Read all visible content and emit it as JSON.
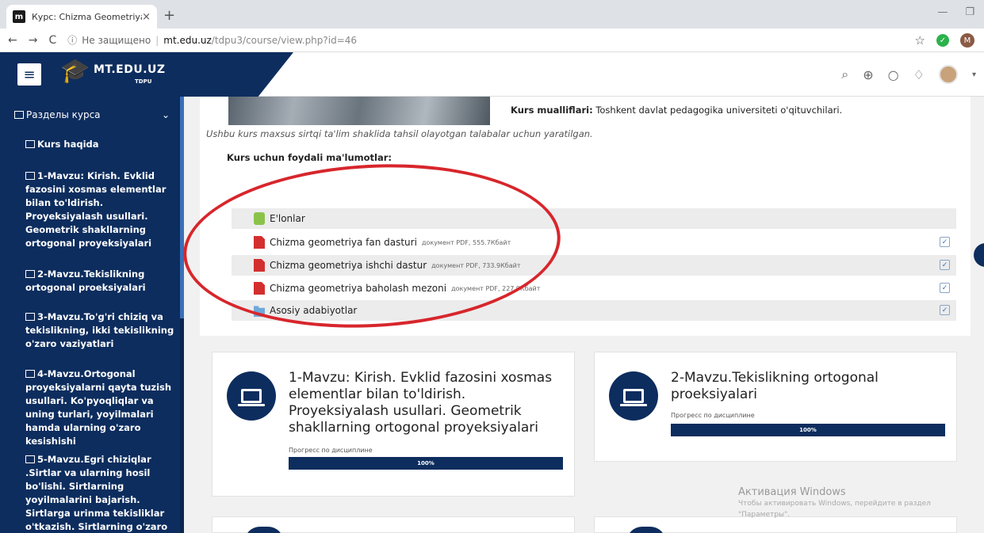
{
  "browser": {
    "tab_title": "Курс: Chizma Geometriya",
    "favicon_letter": "m",
    "tab_close": "×",
    "new_tab": "+",
    "insecure_label": "Не защищено",
    "url_host": "mt.edu.uz",
    "url_path": "/tdpu3/course/view.php?id=46",
    "profile_letter": "M"
  },
  "site": {
    "brand_name": "MT.EDU.UZ",
    "brand_sub": "TDPU"
  },
  "sidebar": {
    "heading": "Разделы курса",
    "items": [
      "Kurs haqida",
      "1-Mavzu: Kirish. Evklid fazosini xosmas elementlar bilan to'ldirish. Proyeksiyalash usullari. Geometrik shakllarning ortogonal proyeksiyalari",
      "2-Mavzu.Tekislikning ortogonal proeksiyalari",
      "3-Mavzu.To'g'ri chiziq va tekislikning, ikki tekislikning o'zaro vaziyatlari",
      "4-Mavzu.Ortogonal proyeksiyalarni qayta tuzish usullari. Ko'pyoqliqlar va uning turlari, yoyilmalari hamda ularning o'zaro kesishishi",
      "5-Mavzu.Egri chiziqlar .Sirtlar va ularning hosil bo'lishi. Sirtlarning yoyilmalarini bajarish. Sirtlarga urinma tekisliklar o'tkazish. Sirtlarning o'zaro kesishishi"
    ]
  },
  "course": {
    "authors_label": "Kurs mualliflari:",
    "authors_text": " Toshkent davlat pedagogika universiteti o'qituvchilari.",
    "description": "Ushbu kurs maxsus sirtqi ta'lim shaklida tahsil olayotgan talabalar uchun yaratilgan.",
    "useful_heading": "Kurs uchun foydali ma'lumotlar:",
    "resources": [
      {
        "label": "E'lonlar",
        "meta": ""
      },
      {
        "label": "Chizma geometriya fan dasturi",
        "meta": "документ PDF, 555.7Кбайт"
      },
      {
        "label": "Chizma geometriya ishchi dastur",
        "meta": "документ PDF, 733.9Кбайт"
      },
      {
        "label": "Chizma geometriya baholash mezoni",
        "meta": "документ PDF, 227.9Кбайт"
      },
      {
        "label": "Asosiy adabiyotlar",
        "meta": ""
      }
    ],
    "check_mark": "✓"
  },
  "topics": [
    {
      "title": "1-Mavzu: Kirish. Evklid fazosini xosmas elementlar bilan to'ldirish. Proyeksiyalash usullari. Geometrik shakllarning ortogonal proyeksiyalari",
      "progress_label": "Прогресс по дисциплине",
      "progress_value": "100%",
      "progress": 1.0
    },
    {
      "title": "2-Mavzu.Tekislikning ortogonal proeksiyalari",
      "progress_label": "Прогресс по дисциплине",
      "progress_value": "100%",
      "progress": 1.0
    }
  ],
  "activation": {
    "title": "Активация Windows",
    "subtitle": "Чтобы активировать Windows, перейдите в раздел \"Параметры\"."
  },
  "colors": {
    "brand": "#0d2d5e",
    "annotation_red": "#d7262c"
  }
}
